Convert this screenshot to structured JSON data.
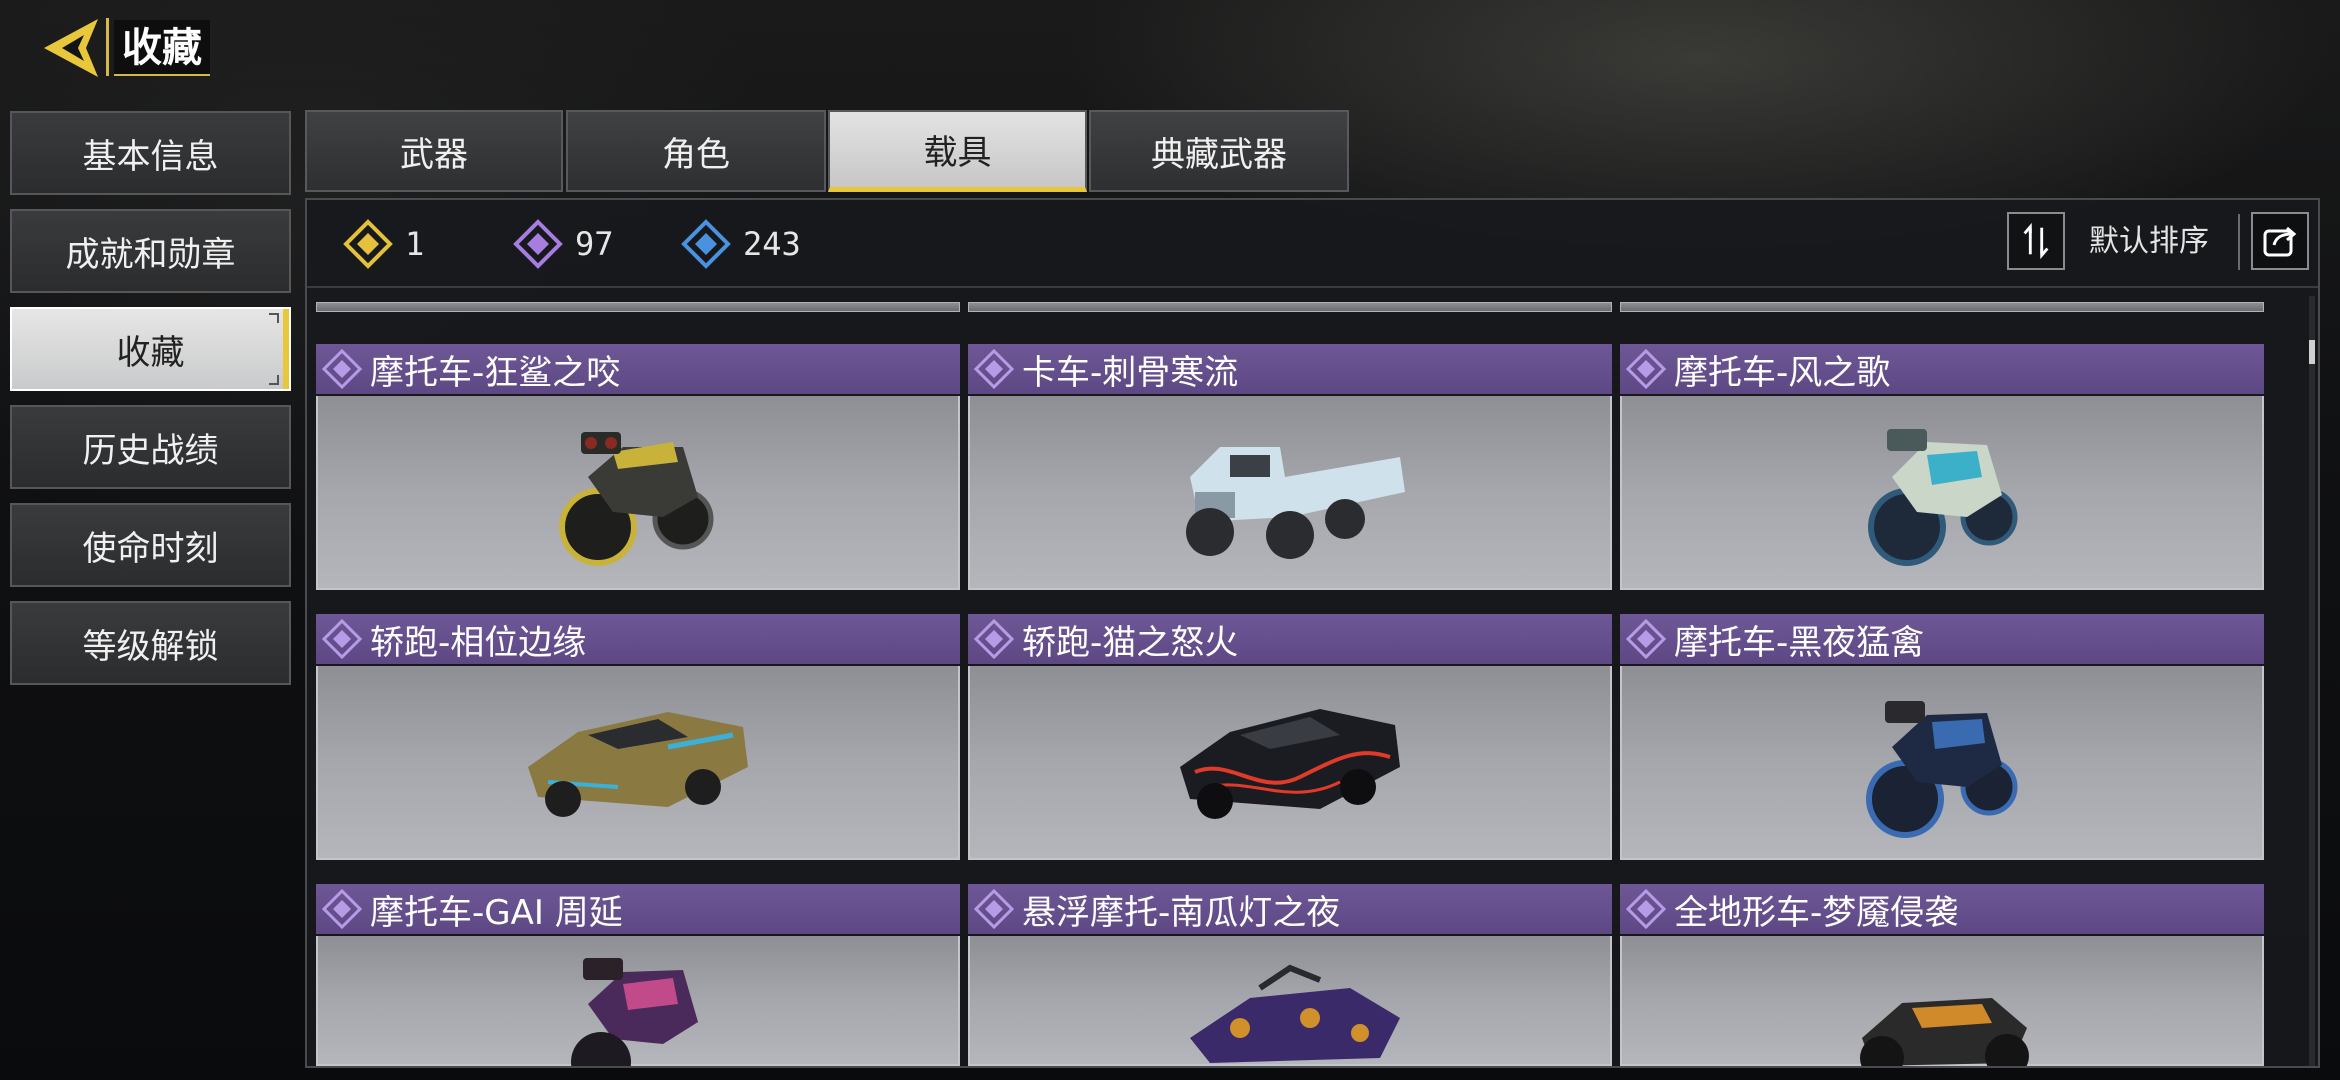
{
  "header": {
    "title": "收藏"
  },
  "sidebar": {
    "items": [
      {
        "label": "基本信息",
        "active": false
      },
      {
        "label": "成就和勋章",
        "active": false
      },
      {
        "label": "收藏",
        "active": true
      },
      {
        "label": "历史战绩",
        "active": false
      },
      {
        "label": "使命时刻",
        "active": false
      },
      {
        "label": "等级解锁",
        "active": false
      }
    ]
  },
  "tabs": [
    {
      "label": "武器",
      "active": false
    },
    {
      "label": "角色",
      "active": false
    },
    {
      "label": "载具",
      "active": true
    },
    {
      "label": "典藏武器",
      "active": false
    }
  ],
  "counters": [
    {
      "rarity": "legendary",
      "icon": "gold-diamond-icon",
      "color": "#e3c13a",
      "value": "1"
    },
    {
      "rarity": "epic",
      "icon": "purple-diamond-icon",
      "color": "#a77ee0",
      "value": "97"
    },
    {
      "rarity": "rare",
      "icon": "blue-diamond-icon",
      "color": "#4a92e0",
      "value": "243"
    }
  ],
  "sort": {
    "label": "默认排序"
  },
  "cards": [
    {
      "name": "摩托车-狂鲨之咬",
      "rarity": "epic",
      "vehicle": "motorcycle",
      "colors": [
        "#3a3a36",
        "#c9b23a"
      ]
    },
    {
      "name": "卡车-刺骨寒流",
      "rarity": "epic",
      "vehicle": "truck",
      "colors": [
        "#cfe1ea",
        "#3b4046"
      ]
    },
    {
      "name": "摩托车-风之歌",
      "rarity": "epic",
      "vehicle": "motorcycle",
      "colors": [
        "#2f5a7a",
        "#c9d6c8"
      ]
    },
    {
      "name": "轿跑-相位边缘",
      "rarity": "epic",
      "vehicle": "car",
      "colors": [
        "#8a7a42",
        "#3bb0d8"
      ]
    },
    {
      "name": "轿跑-猫之怒火",
      "rarity": "epic",
      "vehicle": "car",
      "colors": [
        "#1a1c22",
        "#e03a2a"
      ]
    },
    {
      "name": "摩托车-黑夜猛禽",
      "rarity": "epic",
      "vehicle": "motorcycle",
      "colors": [
        "#1e2a44",
        "#3a6ab0"
      ]
    },
    {
      "name": "摩托车-GAI 周延",
      "rarity": "epic",
      "vehicle": "motorcycle",
      "colors": [
        "#4a2a5a",
        "#c04a8a"
      ]
    },
    {
      "name": "悬浮摩托-南瓜灯之夜",
      "rarity": "epic",
      "vehicle": "hoverbike",
      "colors": [
        "#3a2a6a",
        "#d0902a"
      ]
    },
    {
      "name": "全地形车-梦魇侵袭",
      "rarity": "epic",
      "vehicle": "atv",
      "colors": [
        "#2a2a2a",
        "#d08a2a"
      ]
    }
  ],
  "accent_color": "#e8c83a",
  "epic_header_color": "#6e5796"
}
